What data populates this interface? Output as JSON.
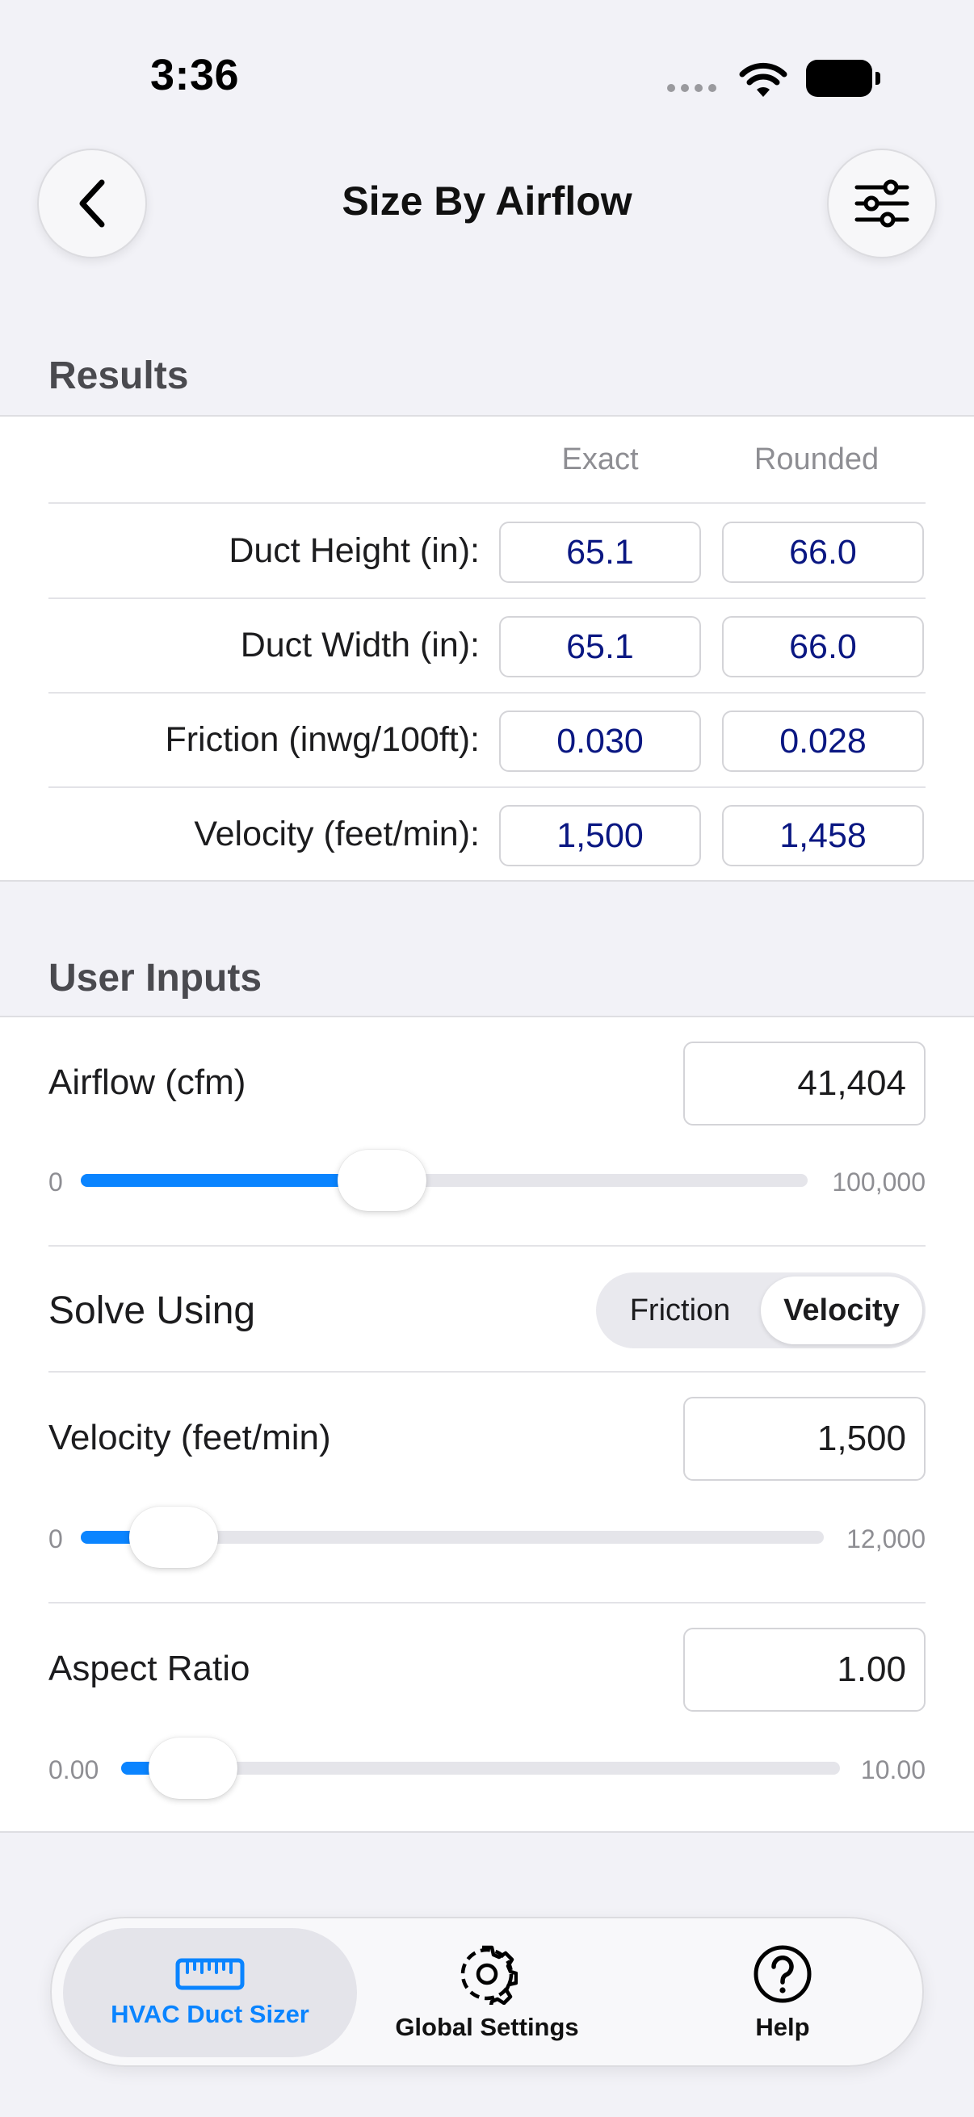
{
  "status_bar": {
    "time": "3:36"
  },
  "nav": {
    "title": "Size By Airflow"
  },
  "results": {
    "header": "Results",
    "col_exact": "Exact",
    "col_rounded": "Rounded",
    "rows": [
      {
        "label": "Duct Height (in):",
        "exact": "65.1",
        "rounded": "66.0"
      },
      {
        "label": "Duct Width (in):",
        "exact": "65.1",
        "rounded": "66.0"
      },
      {
        "label": "Friction (inwg/100ft):",
        "exact": "0.030",
        "rounded": "0.028"
      },
      {
        "label": "Velocity (feet/min):",
        "exact": "1,500",
        "rounded": "1,458"
      }
    ]
  },
  "inputs": {
    "header": "User Inputs",
    "airflow": {
      "label": "Airflow (cfm)",
      "value": "41,404",
      "min": "0",
      "max": "100,000",
      "fraction": 0.41404
    },
    "solve": {
      "label": "Solve Using",
      "options": [
        "Friction",
        "Velocity"
      ],
      "selected": "Velocity"
    },
    "velocity": {
      "label": "Velocity (feet/min)",
      "value": "1,500",
      "min": "0",
      "max": "12,000",
      "fraction": 0.125
    },
    "aspect": {
      "label": "Aspect Ratio",
      "value": "1.00",
      "min": "0.00",
      "max": "10.00",
      "fraction": 0.1
    }
  },
  "tabbar": {
    "items": [
      {
        "label": "HVAC Duct Sizer",
        "icon": "ruler-icon",
        "active": true
      },
      {
        "label": "Global Settings",
        "icon": "gear-icon",
        "active": false
      },
      {
        "label": "Help",
        "icon": "question-icon",
        "active": false
      }
    ]
  },
  "colors": {
    "accent": "#0a84ff",
    "result_text": "#0a1782",
    "background": "#f2f2f7"
  }
}
